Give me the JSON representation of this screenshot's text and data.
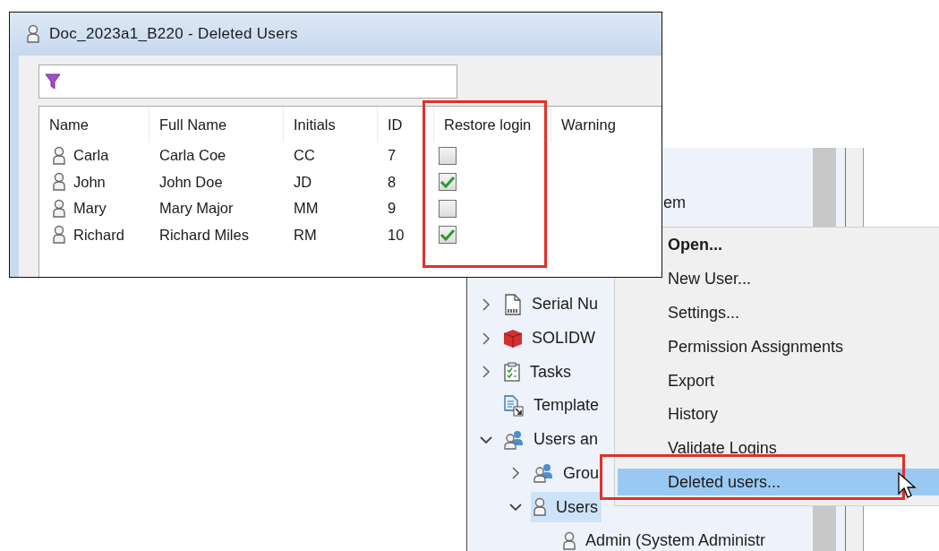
{
  "dialog": {
    "title": "Doc_2023a1_B220 - Deleted Users",
    "columns": [
      "Name",
      "Full Name",
      "Initials",
      "ID",
      "Restore login",
      "Warning"
    ],
    "rows": [
      {
        "name": "Carla",
        "full_name": "Carla Coe",
        "initials": "CC",
        "id": "7",
        "restore_login": false
      },
      {
        "name": "John",
        "full_name": "John Doe",
        "initials": "JD",
        "id": "8",
        "restore_login": true
      },
      {
        "name": "Mary",
        "full_name": "Mary Major",
        "initials": "MM",
        "id": "9",
        "restore_login": false
      },
      {
        "name": "Richard",
        "full_name": "Richard Miles",
        "initials": "RM",
        "id": "10",
        "restore_login": true
      }
    ]
  },
  "tree": {
    "top_fragment": "em",
    "items": [
      {
        "label": "Serial Nu",
        "kind": "serial",
        "expanded": false,
        "selected": false
      },
      {
        "label": "SOLIDW",
        "kind": "cube",
        "expanded": false,
        "selected": false
      },
      {
        "label": "Tasks",
        "kind": "tasks",
        "expanded": false,
        "selected": false
      },
      {
        "label": "Template",
        "kind": "template",
        "selected": false
      },
      {
        "label": "Users an",
        "kind": "group",
        "expanded": true,
        "selected": false,
        "children": [
          {
            "label": "Grou",
            "kind": "group",
            "expanded": false,
            "selected": false
          },
          {
            "label": "Users",
            "kind": "user",
            "expanded": true,
            "selected": true,
            "children": [
              {
                "label": "Admin (System Administr",
                "kind": "user",
                "selected": false
              }
            ]
          }
        ]
      }
    ]
  },
  "context_menu": {
    "items": [
      {
        "label": "Open...",
        "default": true,
        "selected": false
      },
      {
        "label": "New User...",
        "default": false,
        "selected": false
      },
      {
        "label": "Settings...",
        "default": false,
        "selected": false
      },
      {
        "label": "Permission Assignments",
        "default": false,
        "selected": false
      },
      {
        "label": "Export",
        "default": false,
        "selected": false
      },
      {
        "label": "History",
        "default": false,
        "selected": false
      },
      {
        "label": "Validate Logins",
        "default": false,
        "selected": false
      },
      {
        "label": "Deleted users...",
        "default": false,
        "selected": true
      }
    ]
  }
}
